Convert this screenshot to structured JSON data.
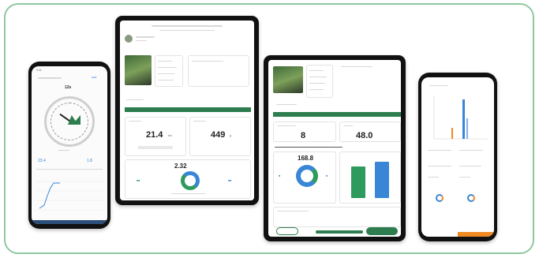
{
  "colors": {
    "frame": "#8fc89f",
    "brand_green": "#2e7d4f",
    "blue": "#3a86d6",
    "orange": "#f08a24"
  },
  "phone_left": {
    "value_label": "12s",
    "stat_left": "23.4",
    "stat_right": "1.8"
  },
  "tablet_center": {
    "stat_a": "21.4",
    "stat_a_unit": "km",
    "stat_b": "449",
    "stat_b_unit": "g",
    "donut_value": "2.32"
  },
  "tablet_right": {
    "stat_a": "8",
    "stat_b": "48.0",
    "ring_value": "168.8",
    "buttons": {
      "left": "",
      "right": ""
    }
  },
  "icons": [
    "clock-dial-icon",
    "donut-chart-icon",
    "bar-chart-icon",
    "line-chart-icon"
  ]
}
